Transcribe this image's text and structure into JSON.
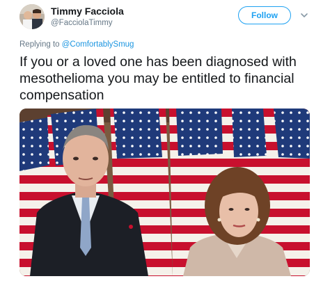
{
  "author": {
    "name": "Timmy Facciola",
    "handle": "@FacciolaTimmy"
  },
  "follow_label": "Follow",
  "reply": {
    "prefix": "Replying to",
    "mention": "@ComfortablySmug"
  },
  "tweet_text": "If you or a loved one has been diagnosed with mesothelioma you may be entitled to financial compensation",
  "icons": {
    "more": "chevron-down-icon"
  },
  "colors": {
    "accent": "#1da1f2",
    "secondary_text": "#657786",
    "text": "#14171a"
  }
}
